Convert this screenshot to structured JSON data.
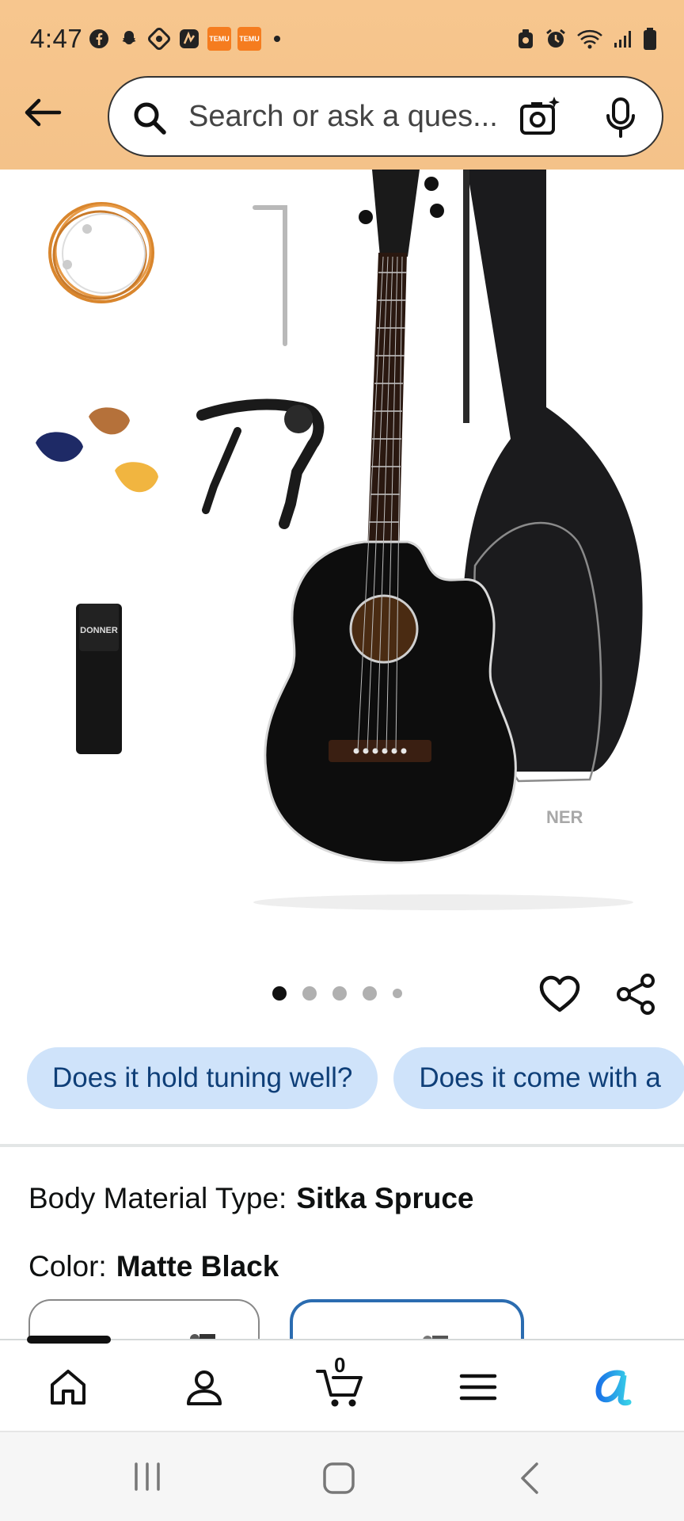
{
  "status_bar": {
    "time": "4:47",
    "temu_label_1": "TEMU",
    "temu_label_2": "TEMU"
  },
  "search": {
    "placeholder": "Search or ask a ques..."
  },
  "product_image": {
    "brand_on_strap": "DONNER",
    "brand_on_bag": "NER"
  },
  "carousel": {
    "total_dots": 5,
    "active_index": 0
  },
  "question_chips": [
    {
      "label": "Does it hold tuning well?"
    },
    {
      "label": "Does it come with a"
    }
  ],
  "attributes": {
    "body_material": {
      "label": "Body Material Type:",
      "value": "Sitka Spruce"
    },
    "color": {
      "label": "Color:",
      "value": "Matte Black"
    }
  },
  "bottom_nav": {
    "cart_count": "0",
    "items": [
      "home-icon",
      "account-icon",
      "cart-icon",
      "menu-icon",
      "ai-assistant-icon"
    ],
    "accent": "#1a9df0"
  },
  "colors": {
    "header": "#f6c48b",
    "chip_bg": "#cfe3fa",
    "chip_text": "#0f3f78",
    "selected_swatch": "#2b6cb0"
  }
}
